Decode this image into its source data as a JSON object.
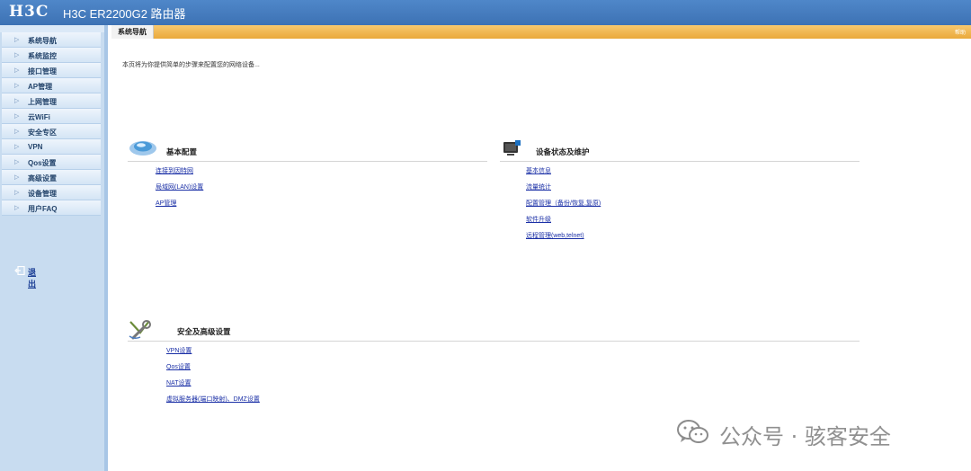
{
  "header": {
    "logo": "H3C",
    "title": "H3C ER2200G2 路由器"
  },
  "sidebar": {
    "items": [
      {
        "label": "系统导航"
      },
      {
        "label": "系统监控"
      },
      {
        "label": "接口管理"
      },
      {
        "label": "AP管理"
      },
      {
        "label": "上网管理"
      },
      {
        "label": "云WiFi"
      },
      {
        "label": "安全专区"
      },
      {
        "label": "VPN"
      },
      {
        "label": "Qos设置"
      },
      {
        "label": "高级设置"
      },
      {
        "label": "设备管理"
      },
      {
        "label": "用户FAQ"
      }
    ],
    "logout": "退出"
  },
  "main": {
    "tab": "系统导航",
    "help": "帮助",
    "intro": "本页将为你提供简单的步骤来配置您的网络设备...",
    "sections": {
      "basic": {
        "title": "基本配置",
        "links": [
          "连接到因特网",
          "局域网(LAN)设置",
          "AP管理"
        ]
      },
      "status": {
        "title": "设备状态及维护",
        "links": [
          "基本信息",
          "流量统计",
          "配置管理（备份/恢复,复原)",
          "软件升级",
          "远程管理(web,telnet)"
        ]
      },
      "security": {
        "title": "安全及高级设置",
        "links": [
          "VPN设置",
          "Qos设置",
          "NAT设置",
          "虚拟服务器(端口映射)、DMZ设置"
        ]
      }
    }
  },
  "watermark": {
    "text": "公众号 · 骇客安全"
  },
  "colors": {
    "header_blue": "#4a80c2",
    "tab_orange": "#eeb24b",
    "link_blue": "#1a2fa6",
    "sidebar_bg": "#c8dcf0"
  }
}
